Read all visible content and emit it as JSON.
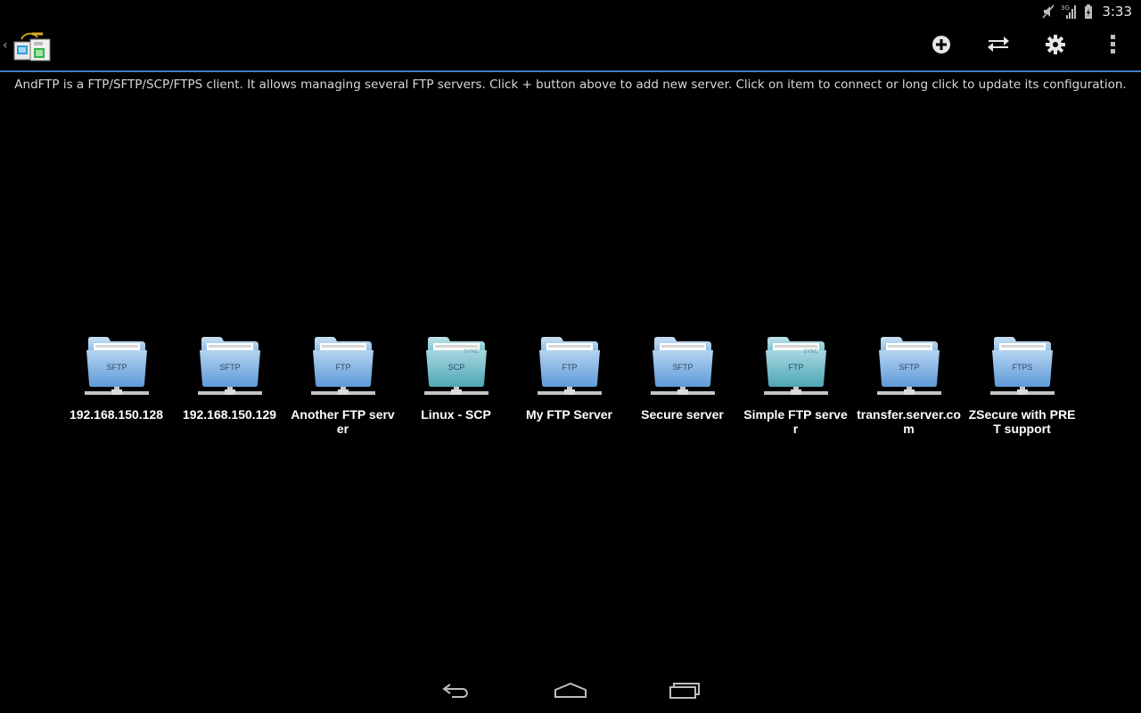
{
  "status_bar": {
    "time": "3:33",
    "network_label": "3G",
    "icons": [
      "muted-icon",
      "signal-icon",
      "battery-icon"
    ]
  },
  "action_bar": {
    "app_icon": "andftp-app-icon",
    "actions": [
      {
        "name": "add-server-button",
        "icon": "plus-circle-icon"
      },
      {
        "name": "transfers-button",
        "icon": "swap-arrows-icon"
      },
      {
        "name": "settings-button",
        "icon": "gear-icon"
      },
      {
        "name": "overflow-menu-button",
        "icon": "more-vert-icon"
      }
    ],
    "accent_color": "#3f7fbf"
  },
  "description": "AndFTP is a FTP/SFTP/SCP/FTPS client. It allows managing several FTP servers. Click + button above to add new server. Click on item to connect or long click to update its configuration.",
  "servers": [
    {
      "name": "192.168.150.128",
      "protocol": "SFTP",
      "sync": false
    },
    {
      "name": "192.168.150.129",
      "protocol": "SFTP",
      "sync": false
    },
    {
      "name": "Another FTP server",
      "protocol": "FTP",
      "sync": false
    },
    {
      "name": "Linux - SCP",
      "protocol": "SCP",
      "sync": true
    },
    {
      "name": "My FTP Server",
      "protocol": "FTP",
      "sync": false
    },
    {
      "name": "Secure server",
      "protocol": "SFTP",
      "sync": false
    },
    {
      "name": "Simple FTP server",
      "protocol": "FTP",
      "sync": true
    },
    {
      "name": "transfer.server.com",
      "protocol": "SFTP",
      "sync": false
    },
    {
      "name": "ZSecure with PRET support",
      "protocol": "FTPS",
      "sync": false
    }
  ],
  "sync_label": "SYNC",
  "nav_bar": {
    "buttons": [
      "back-icon",
      "home-icon",
      "recents-icon"
    ]
  }
}
